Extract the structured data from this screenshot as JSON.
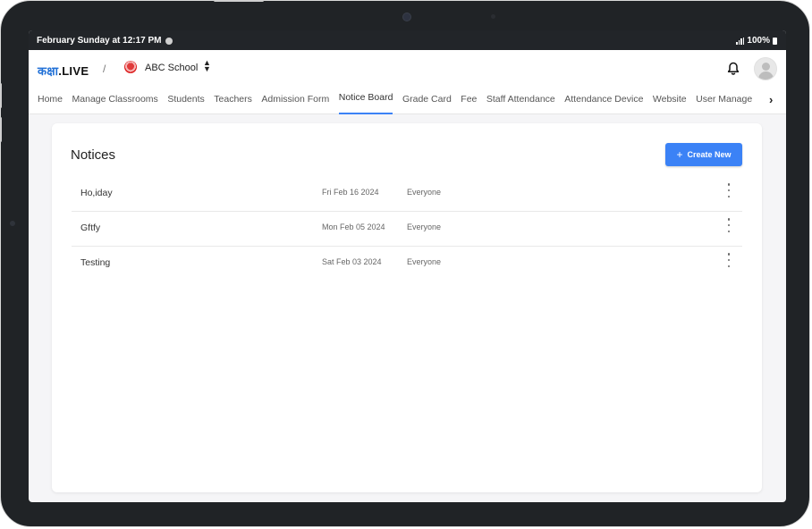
{
  "statusbar": {
    "datetime": "February Sunday at 12:17 PM",
    "battery": "100%"
  },
  "appbar": {
    "logo_hindi": "कक्षा",
    "logo_suffix": ".LIVE",
    "separator": "/",
    "school_name": "ABC School"
  },
  "nav": {
    "items": [
      {
        "label": "Home"
      },
      {
        "label": "Manage Classrooms"
      },
      {
        "label": "Students"
      },
      {
        "label": "Teachers"
      },
      {
        "label": "Admission Form"
      },
      {
        "label": "Notice Board",
        "active": true
      },
      {
        "label": "Grade Card"
      },
      {
        "label": "Fee"
      },
      {
        "label": "Staff Attendance"
      },
      {
        "label": "Attendance Device"
      },
      {
        "label": "Website"
      },
      {
        "label": "User Manage"
      }
    ]
  },
  "notices": {
    "title": "Notices",
    "create_label": "Create New",
    "rows": [
      {
        "title": "Ho,iday",
        "date": "Fri Feb 16 2024",
        "audience": "Everyone"
      },
      {
        "title": "Gftfy",
        "date": "Mon Feb 05 2024",
        "audience": "Everyone"
      },
      {
        "title": "Testing",
        "date": "Sat Feb 03 2024",
        "audience": "Everyone"
      }
    ]
  },
  "colors": {
    "accent": "#3b82f6",
    "statusbar": "#222529",
    "bezel": "#202326"
  }
}
